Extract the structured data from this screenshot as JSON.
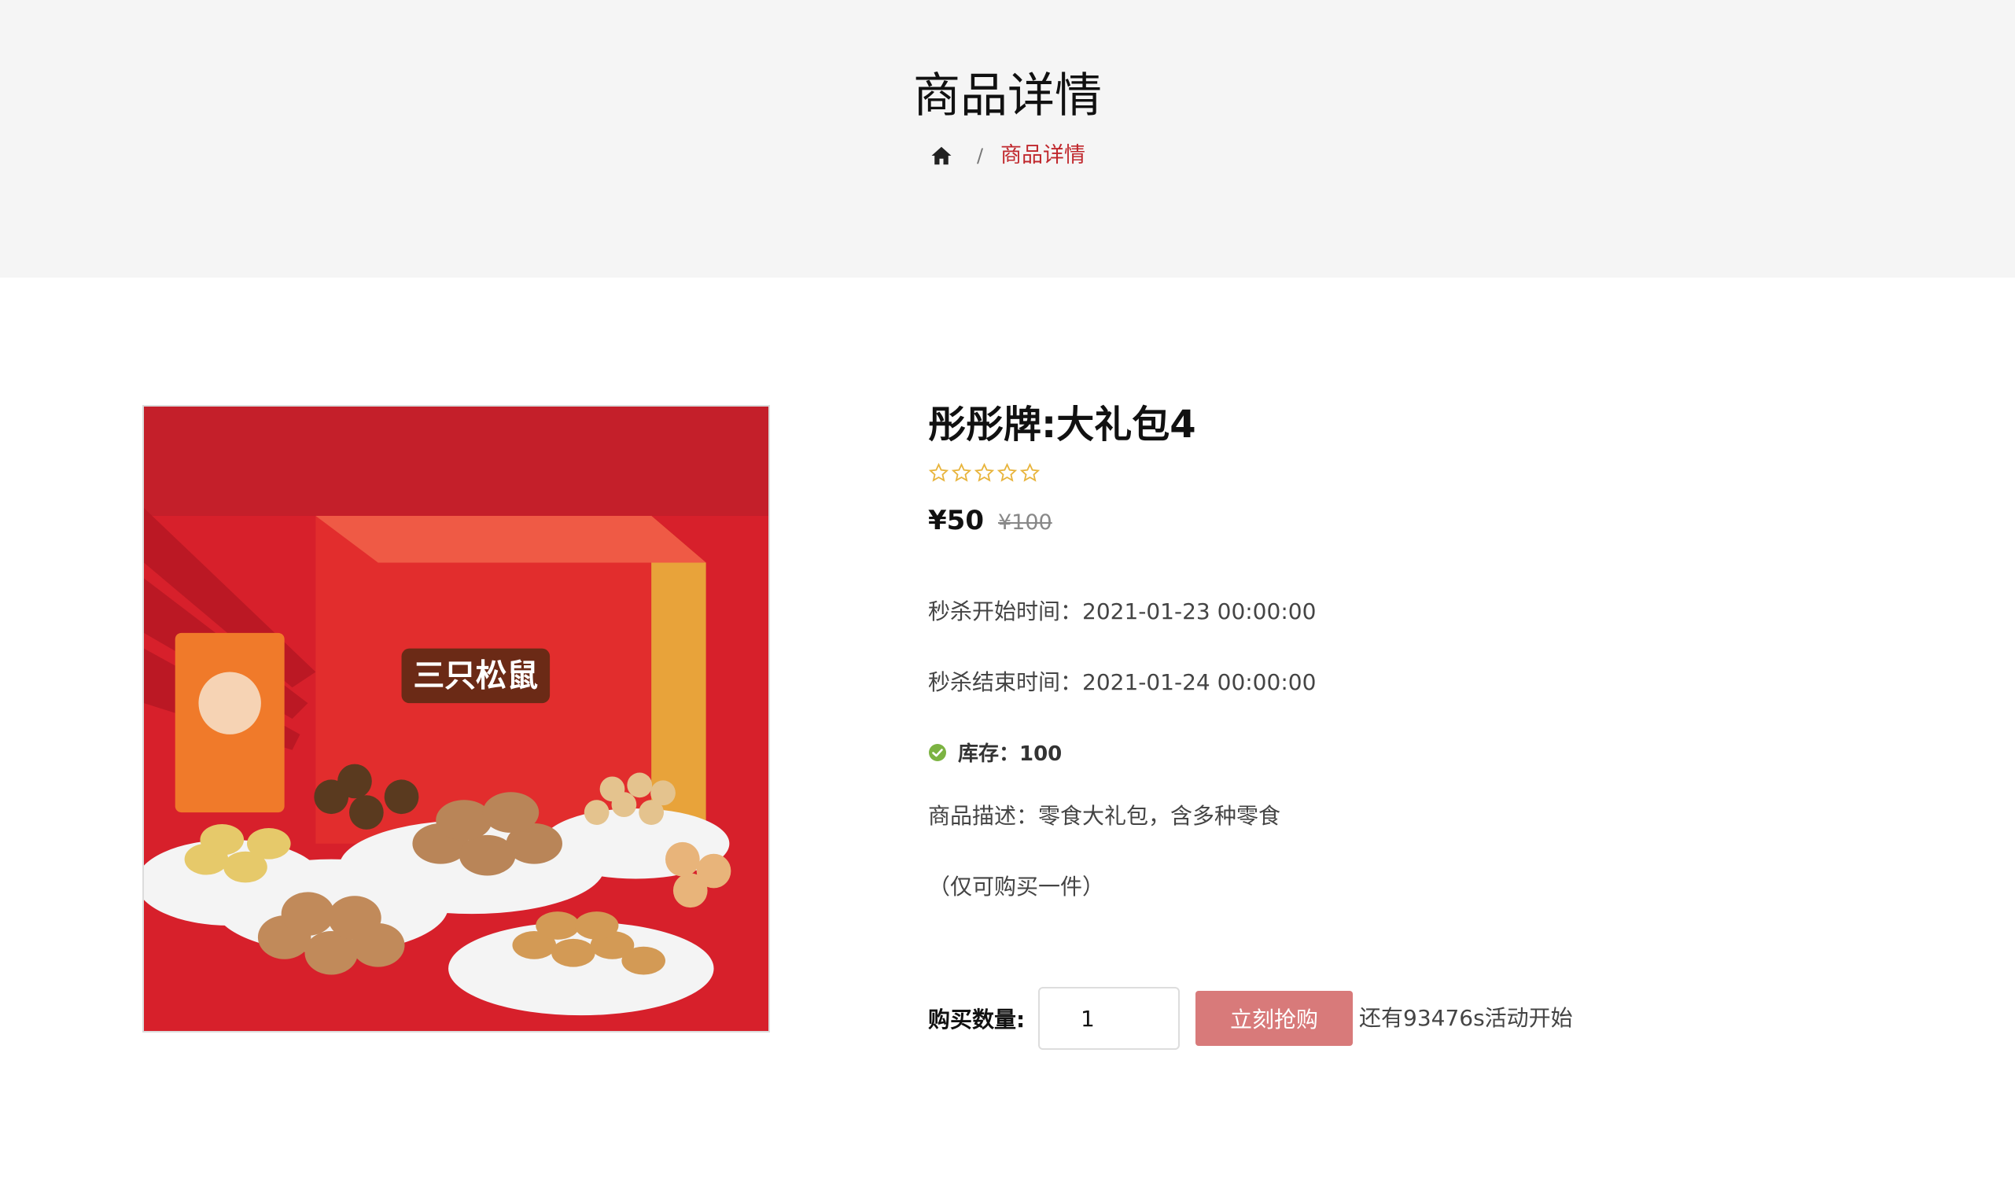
{
  "header": {
    "title": "商品详情",
    "breadcrumb": {
      "home_icon": "home-icon",
      "separator": "/",
      "current": "商品详情"
    }
  },
  "product": {
    "name": "彤彤牌:大礼包4",
    "rating": {
      "value": 0,
      "max": 5
    },
    "price_current": "¥50",
    "price_original": "¥100",
    "seckill_start": "秒杀开始时间：2021-01-23 00:00:00",
    "seckill_end": "秒杀结束时间：2021-01-24 00:00:00",
    "stock": "库存：100",
    "description": "商品描述：零食大礼包，含多种零食",
    "purchase_limit": "（仅可购买一件）",
    "image_brand_text": "三只松鼠"
  },
  "purchase": {
    "qty_label": "购买数量:",
    "qty_value": "1",
    "buy_button": "立刻抢购",
    "countdown": "还有93476s活动开始"
  },
  "colors": {
    "accent": "#c0282d",
    "button": "#d87a7a",
    "star": "#e8b43c",
    "stock_check": "#7cb342",
    "header_bg": "#f5f5f5"
  }
}
